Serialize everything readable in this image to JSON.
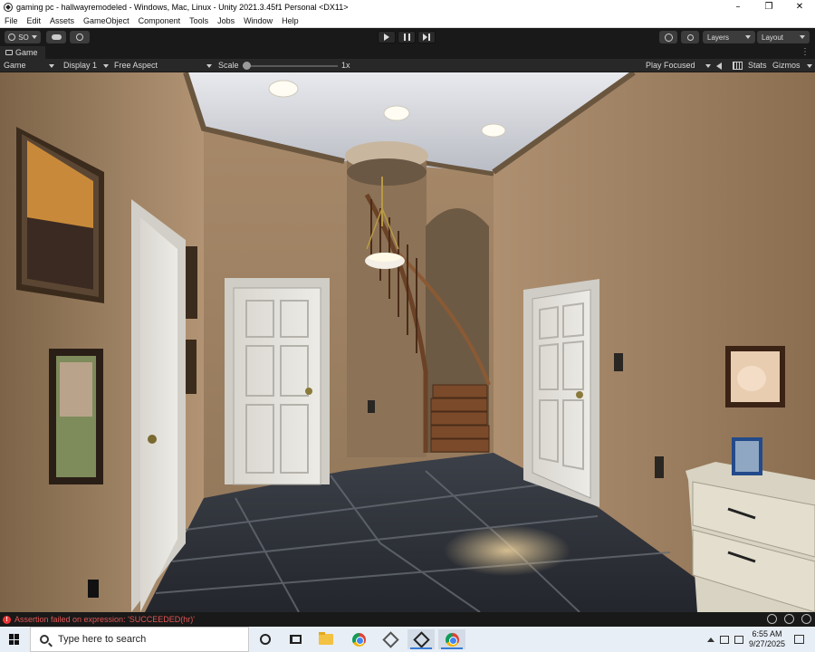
{
  "titlebar": {
    "title": "gaming pc - hallwayremodeled - Windows, Mac, Linux - Unity 2021.3.45f1 Personal <DX11>",
    "minimize": "–",
    "restore": "❐",
    "close": "✕"
  },
  "menu": {
    "items": [
      "File",
      "Edit",
      "Assets",
      "GameObject",
      "Component",
      "Tools",
      "Jobs",
      "Window",
      "Help"
    ]
  },
  "toolbar": {
    "account_label": "SO",
    "layers_label": "Layers",
    "layout_label": "Layout"
  },
  "tab": {
    "label": "Game",
    "menu": "⋮"
  },
  "gamebar": {
    "view_dropdown": "Game",
    "display_dropdown": "Display 1",
    "aspect_dropdown": "Free Aspect",
    "scale_label": "Scale",
    "scale_value": "1x",
    "scale_fraction": 0.0,
    "play_mode_dropdown": "Play Focused",
    "stats_label": "Stats",
    "gizmos_label": "Gizmos"
  },
  "status": {
    "error_icon": "!",
    "message": "Assertion failed on expression: 'SUCCEEDED(hr)'"
  },
  "taskbar": {
    "search_placeholder": "Type here to search",
    "time": "6:55 AM",
    "date": "9/27/2025"
  },
  "colors": {
    "accent": "#3a7bd5",
    "error": "#e35555",
    "editor_bg": "#191919",
    "panel_bg": "#282828"
  }
}
